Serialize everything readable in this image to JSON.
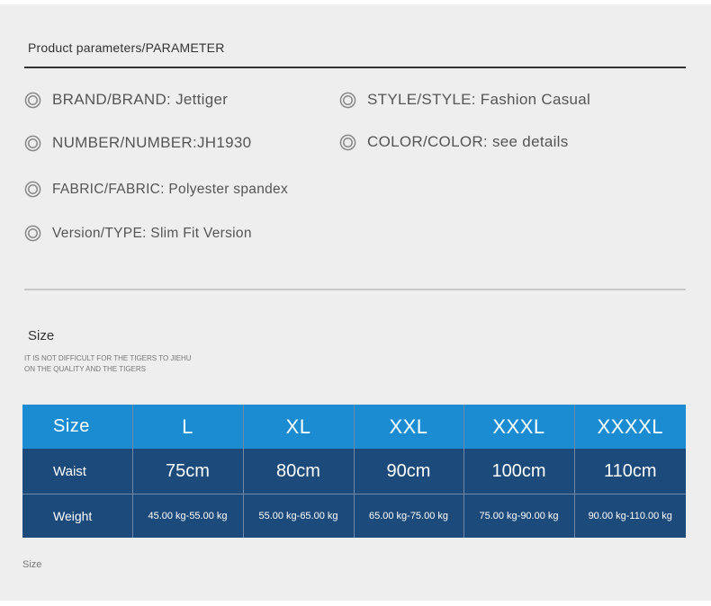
{
  "header": {
    "title": "Product parameters/PARAMETER"
  },
  "params": [
    {
      "text": "BRAND/BRAND: Jettiger"
    },
    {
      "text": "STYLE/STYLE: Fashion Casual"
    },
    {
      "text": "NUMBER/NUMBER:JH1930"
    },
    {
      "text": "COLOR/COLOR: see details"
    },
    {
      "text": "FABRIC/FABRIC: Polyester spandex"
    },
    {
      "text": "Version/TYPE: Slim Fit Version"
    }
  ],
  "size_section": {
    "title": "Size",
    "subtitle_line1": "IT IS NOT DIFFICULT FOR THE TIGERS TO JIEHU",
    "subtitle_line2": "ON THE QUALITY AND THE TIGERS"
  },
  "size_table": {
    "header": [
      "Size",
      "L",
      "XL",
      "XXL",
      "XXXL",
      "XXXXL"
    ],
    "rows": [
      [
        "Waist",
        "75cm",
        "80cm",
        "90cm",
        "100cm",
        "110cm"
      ],
      [
        "Weight",
        "45.00 kg-55.00 kg",
        "55.00 kg-65.00 kg",
        "65.00 kg-75.00 kg",
        "75.00 kg-90.00 kg",
        "90.00 kg-110.00 kg"
      ]
    ]
  },
  "footer": {
    "note": "Size"
  },
  "colors": {
    "panel": "#eeeeee",
    "table_header": "#1b8bd2",
    "table_body": "#1c4a7a",
    "ring": "#888888"
  },
  "icons": {
    "param_marker": "concentric-circle-icon"
  }
}
